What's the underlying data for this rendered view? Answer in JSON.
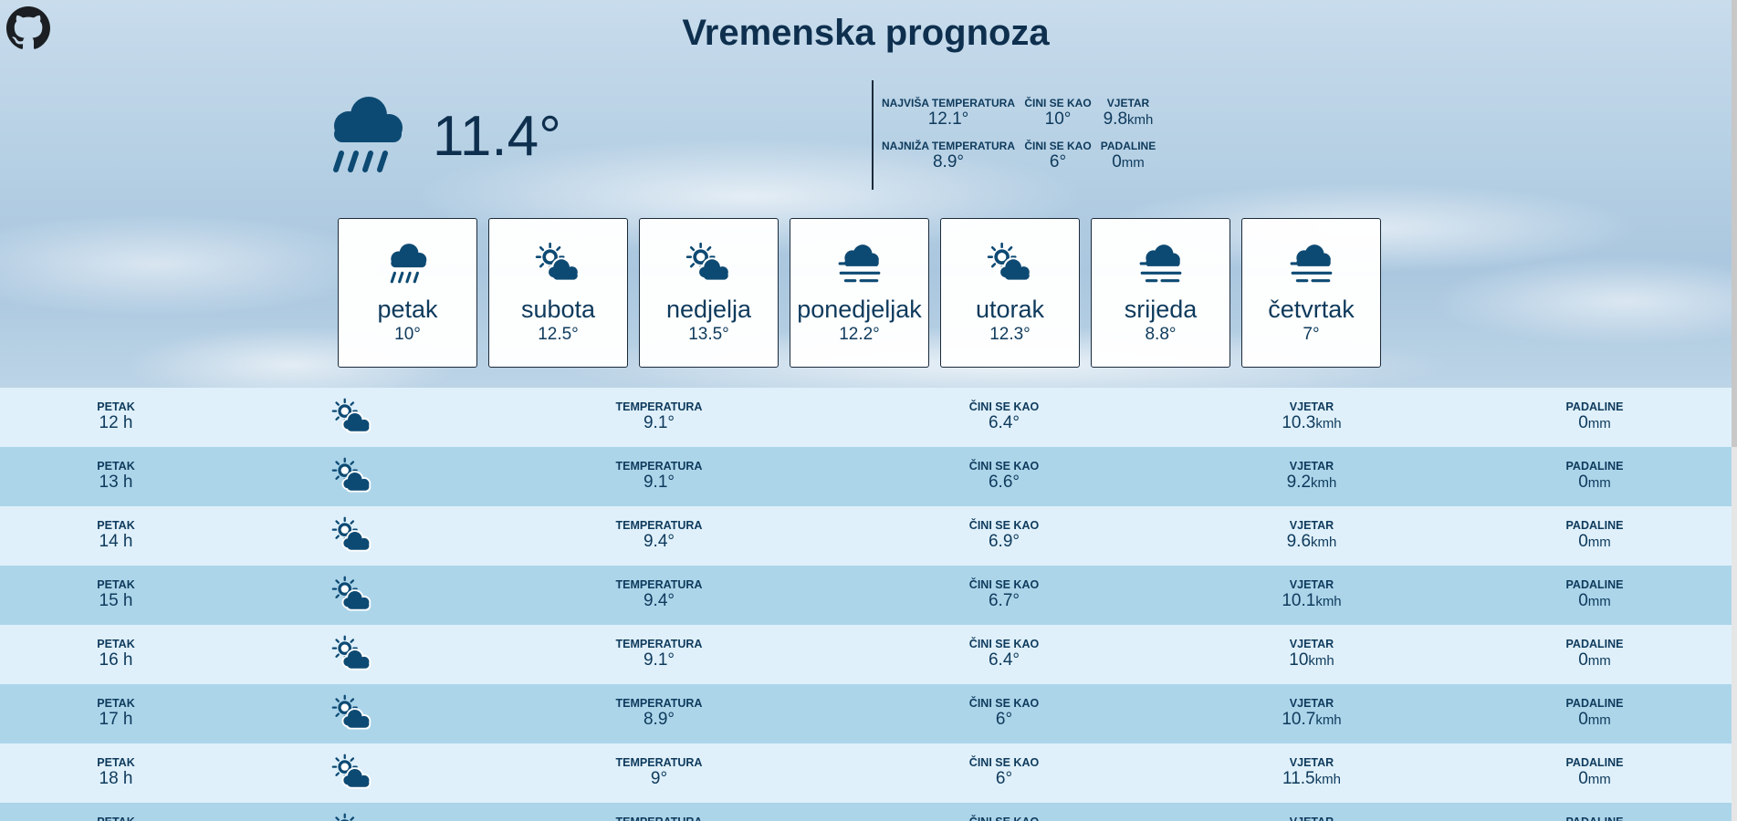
{
  "title": "Vremenska prognoza",
  "current": {
    "icon": "rain-cloud-icon",
    "temperature": "11.4°",
    "stats": [
      {
        "label": "NAJVIŠA TEMPERATURA",
        "value": "12.1°",
        "unit": ""
      },
      {
        "label": "ČINI SE KAO",
        "value": "10°",
        "unit": ""
      },
      {
        "label": "VJETAR",
        "value": "9.8",
        "unit": "kmh"
      },
      {
        "label": "NAJNIŽA TEMPERATURA",
        "value": "8.9°",
        "unit": ""
      },
      {
        "label": "ČINI SE KAO",
        "value": "6°",
        "unit": ""
      },
      {
        "label": "PADALINE",
        "value": "0",
        "unit": "mm"
      }
    ]
  },
  "days": [
    {
      "name": "petak",
      "temp": "10°",
      "icon": "rain-cloud-icon"
    },
    {
      "name": "subota",
      "temp": "12.5°",
      "icon": "sun-cloud-icon"
    },
    {
      "name": "nedjelja",
      "temp": "13.5°",
      "icon": "sun-cloud-icon"
    },
    {
      "name": "ponedjeljak",
      "temp": "12.2°",
      "icon": "fog-cloud-icon"
    },
    {
      "name": "utorak",
      "temp": "12.3°",
      "icon": "sun-cloud-icon"
    },
    {
      "name": "srijeda",
      "temp": "8.8°",
      "icon": "fog-cloud-icon"
    },
    {
      "name": "četvrtak",
      "temp": "7°",
      "icon": "fog-cloud-icon"
    }
  ],
  "hourly_labels": {
    "temperature": "TEMPERATURA",
    "feels_like": "ČINI SE KAO",
    "wind": "VJETAR",
    "precipitation": "PADALINE",
    "wind_unit": "kmh",
    "precip_unit": "mm"
  },
  "hourly": [
    {
      "day": "PETAK",
      "hour": "12 h",
      "icon": "sun-cloud-icon",
      "temp": "9.1°",
      "feels": "6.4°",
      "wind": "10.3",
      "precip": "0"
    },
    {
      "day": "PETAK",
      "hour": "13 h",
      "icon": "sun-cloud-icon",
      "temp": "9.1°",
      "feels": "6.6°",
      "wind": "9.2",
      "precip": "0"
    },
    {
      "day": "PETAK",
      "hour": "14 h",
      "icon": "sun-cloud-icon",
      "temp": "9.4°",
      "feels": "6.9°",
      "wind": "9.6",
      "precip": "0"
    },
    {
      "day": "PETAK",
      "hour": "15 h",
      "icon": "sun-cloud-icon",
      "temp": "9.4°",
      "feels": "6.7°",
      "wind": "10.1",
      "precip": "0"
    },
    {
      "day": "PETAK",
      "hour": "16 h",
      "icon": "sun-cloud-icon",
      "temp": "9.1°",
      "feels": "6.4°",
      "wind": "10",
      "precip": "0"
    },
    {
      "day": "PETAK",
      "hour": "17 h",
      "icon": "sun-cloud-icon",
      "temp": "8.9°",
      "feels": "6°",
      "wind": "10.7",
      "precip": "0"
    },
    {
      "day": "PETAK",
      "hour": "18 h",
      "icon": "sun-cloud-icon",
      "temp": "9°",
      "feels": "6°",
      "wind": "11.5",
      "precip": "0"
    },
    {
      "day": "PETAK",
      "hour": "",
      "icon": "sun-cloud-icon",
      "temp": "",
      "feels": "",
      "wind": "",
      "precip": ""
    }
  ],
  "colors": {
    "primary": "#0e3a5c",
    "row_light": "#dff0fa",
    "row_dark": "#acd5ea",
    "icon": "#0d4a73"
  }
}
